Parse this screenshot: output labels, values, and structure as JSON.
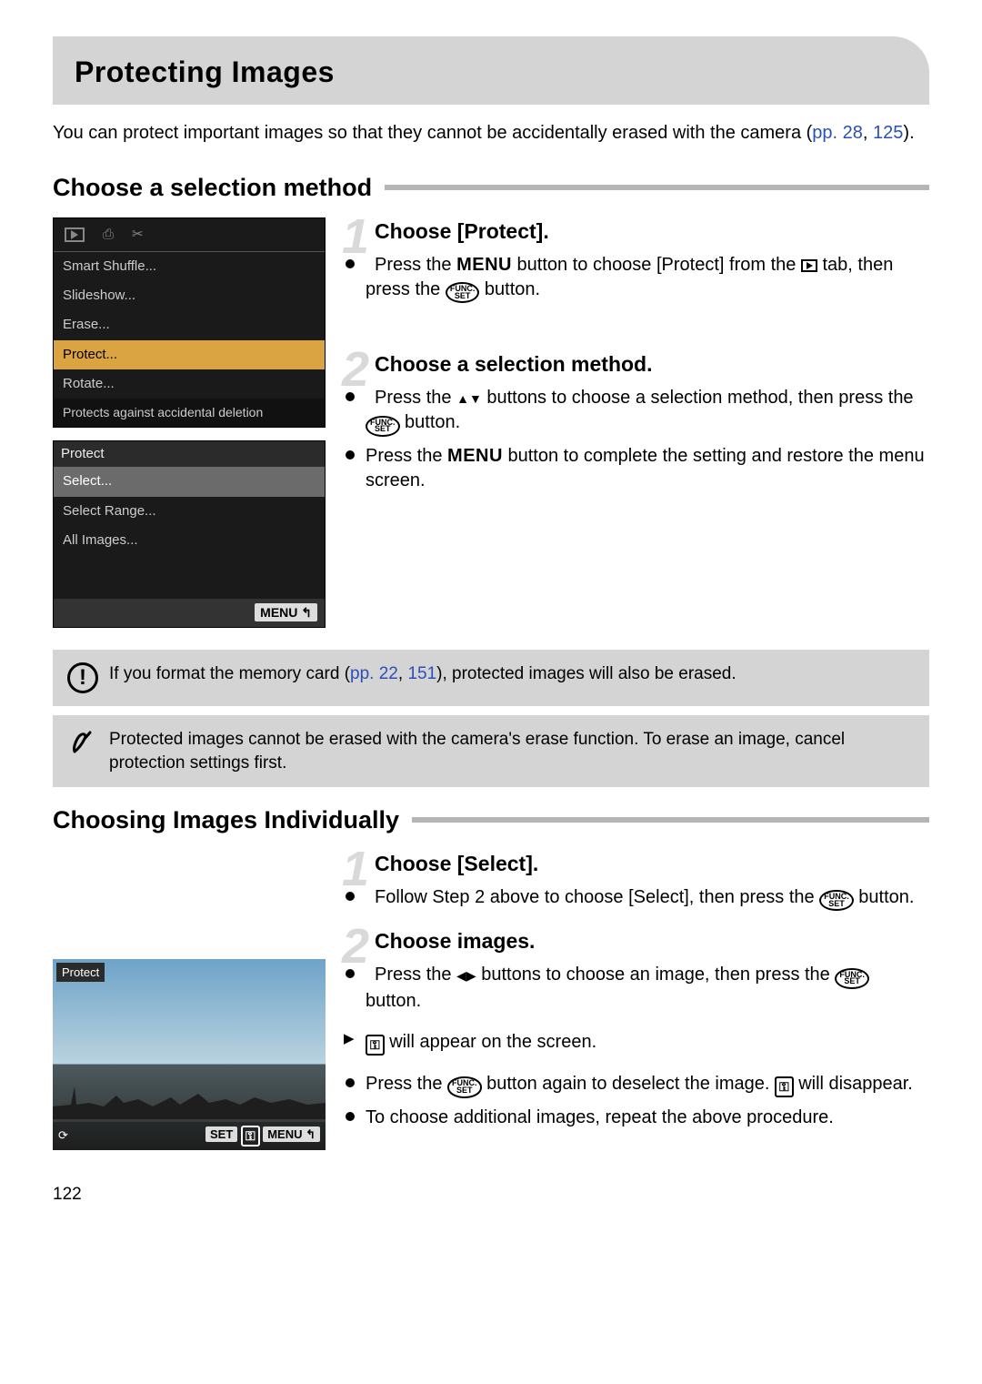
{
  "title": "Protecting Images",
  "intro": {
    "text1": "You can protect important images so that they cannot be accidentally erased with the camera ",
    "refs_label": "(pp. ",
    "ref1": "28",
    "ref_sep": ", ",
    "ref2": "125",
    "refs_close": ")."
  },
  "section1_heading": "Choose a selection method",
  "lcd1": {
    "items": [
      "Smart Shuffle...",
      "Slideshow...",
      "Erase...",
      "Protect...",
      "Rotate..."
    ],
    "highlighted_index": 3,
    "footer": "Protects against accidental deletion"
  },
  "lcd2": {
    "header": "Protect",
    "items": [
      "Select...",
      "Select Range...",
      "All Images..."
    ],
    "selected_index": 0,
    "footer_label": "MENU ↰"
  },
  "step1": {
    "num": "1",
    "title": "Choose [Protect].",
    "b1a": "Press the ",
    "menu_word": "MENU",
    "b1b": " button to choose [Protect] from the ",
    "b1c": " tab, then press the ",
    "func_top": "FUNC.",
    "func_bot": "SET",
    "b1d": " button."
  },
  "step2": {
    "num": "2",
    "title": "Choose a selection method.",
    "b1a": "Press the ",
    "b1b": " buttons to choose a selection method, then press the ",
    "b1c": " button.",
    "b2a": "Press the ",
    "b2b": " button to complete the setting and restore the menu screen."
  },
  "warning": {
    "t1": "If you format the memory card ",
    "refs_label": "(pp. ",
    "ref1": "22",
    "ref_sep": ", ",
    "ref2": "151",
    "refs_close": ")",
    "t2": ", protected images will also be erased."
  },
  "note": {
    "t": "Protected images cannot be erased with the camera's erase function. To erase an image, cancel protection settings first."
  },
  "section2_heading": "Choosing Images Individually",
  "stepB1": {
    "num": "1",
    "title": "Choose [Select].",
    "b1a": "Follow Step 2 above to choose [Select], then press the ",
    "b1b": " button."
  },
  "stepB2": {
    "num": "2",
    "title": "Choose images.",
    "b1a": "Press the ",
    "b1b": " buttons to choose an image, then press the ",
    "b1c": " button.",
    "b2a": " will appear on the screen.",
    "b3a": "Press the ",
    "b3b": " button again to deselect the image. ",
    "b3c": " will disappear.",
    "b4": "To choose additional images, repeat the above procedure."
  },
  "photo": {
    "label": "Protect",
    "set_label": "SET",
    "key_label": "⚿",
    "menu_label": "MENU ↰"
  },
  "key_symbol": "⚿",
  "page_number": "122"
}
